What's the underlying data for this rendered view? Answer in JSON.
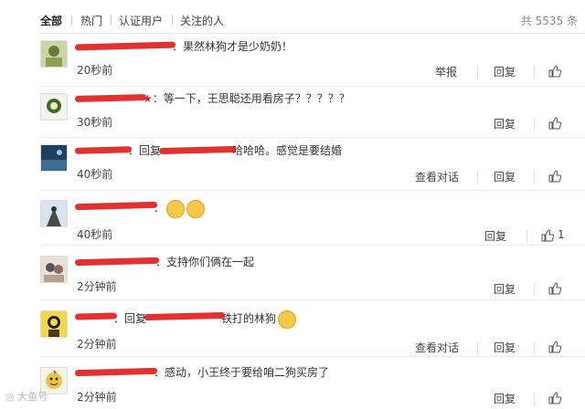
{
  "filter_tabs": [
    "全部",
    "热门",
    "认证用户",
    "关注的人"
  ],
  "total_label": "共 5535 条",
  "actions": {
    "report": "举报",
    "reply": "回复",
    "view_dialog": "查看对话"
  },
  "comments": [
    {
      "text": "：果然林狗才是少奶奶！",
      "time": "20秒前",
      "like_count": ""
    },
    {
      "text": "：等一下，王思聪还用看房子？？？？？",
      "time": "30秒前",
      "like_count": ""
    },
    {
      "reply_prefix": "：回复",
      "text": "哈哈哈。感觉是要结婚",
      "time": "40秒前",
      "like_count": ""
    },
    {
      "text": "：",
      "time": "40秒前",
      "like_count": "1"
    },
    {
      "text": "：支持你们俩在一起",
      "time": "2分钟前",
      "like_count": ""
    },
    {
      "reply_prefix": "：回复",
      "text": "铁打的林狗",
      "time": "2分钟前",
      "like_count": ""
    },
    {
      "text": "：感动，小王终于要给咱二狗买房了",
      "time": "2分钟前",
      "like_count": ""
    }
  ],
  "watermark": "大鱼号"
}
